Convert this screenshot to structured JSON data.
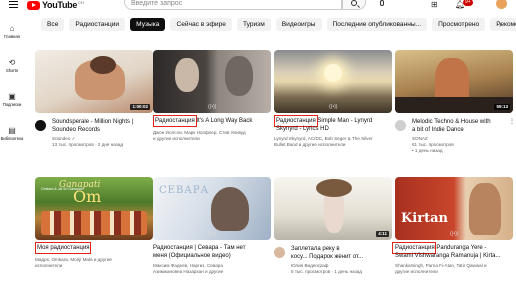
{
  "header": {
    "logo_text": "YouTube",
    "logo_country": "CH",
    "search_placeholder": "Введите запрос",
    "notifications_count": "9+"
  },
  "sidebar": {
    "items": [
      {
        "label": "Главная",
        "icon": "home-icon"
      },
      {
        "label": "Shorts",
        "icon": "shorts-icon"
      },
      {
        "label": "Подписки",
        "icon": "subscriptions-icon"
      },
      {
        "label": "Библиотека",
        "icon": "library-icon"
      }
    ]
  },
  "chips": [
    "Все",
    "Радиостанции",
    "Музыка",
    "Сейчас в эфире",
    "Туризм",
    "Видеоигры",
    "Последние опубликованны...",
    "Просмотрено",
    "Рекомендов"
  ],
  "chips_active": "Музыка",
  "videos": [
    {
      "title1": "Soundsperale - Million Nights |",
      "title2": "Soundeo Records",
      "channel": "Soundeo ✓",
      "stats": "13 тыс. просмотров · 2 дня назад",
      "duration": "1:00:02",
      "colors": [
        "#e9e2d9",
        "#b9876a"
      ]
    },
    {
      "label": "Радиостанция",
      "title1": "It's A Long Way Back",
      "artists": "Джон Иллсли, Марк Нопфлер, Стив Уинвуд",
      "more": "и другие исполнители",
      "colors": [
        "#3f3a38",
        "#9a8f86"
      ]
    },
    {
      "label": "Радиостанция",
      "title1": "Simple Man - Lynyrd",
      "title2": "Skynyrd - Lyrics HD",
      "artists": "Lynyrd Skynyrd, AC/DC, Bob Seger & The Silver",
      "more": "Bullet Band и другие исполнители",
      "colors": [
        "#d8c8a8",
        "#6a5a42"
      ]
    },
    {
      "title1": "Melodic Techno & House with",
      "title2": "a bit of Indie Dance",
      "channel": "SONAZ",
      "stats": "61 тыс. просмотров",
      "ago": "1 день назад",
      "duration": "59:13",
      "colors": [
        "#c0a46e",
        "#5a3e2a"
      ]
    },
    {
      "label": "Моя радиостанция",
      "thumb_text1": "Ganapati",
      "thumb_text2": "Om",
      "thumb_sub": "Omkara & Jai Sri Ganapati",
      "artists": "Мадрх, Omkara, Moriji Mala и другие",
      "more": "исполнители",
      "colors": [
        "#4a7a2e",
        "#c08a3a"
      ]
    },
    {
      "title1": "Радиостанция | Севара - Там нет",
      "title2": "меня (Официальное видео)",
      "artists": "Максим Фадеев, Наргиз, Севара",
      "more": "Азимжановна Назархан и другие",
      "thumb_text1": "СЕВАРА",
      "colors": [
        "#e8edf2",
        "#8fa2b8"
      ]
    },
    {
      "title1": "Заплетала реку в",
      "title2": "косу... Подарок женит от...",
      "channel": "Юлия Видеограф",
      "stats": "5 тыс. просмотров · 1 день назад",
      "duration": "4:11",
      "colors": [
        "#f2efe6",
        "#a8a59c"
      ]
    },
    {
      "label": "Радиостанция",
      "title1": "Panduranga Yere -",
      "title2": "Swami Vishwaranga Ramanuja | Kirta...",
      "artists": "Shankarsingh, Parna Fi-Atan, Tatir Qawwal и",
      "more": "другие исполнители",
      "thumb_text1": "Kirtan",
      "colors": [
        "#b63a2a",
        "#e6c9a8"
      ]
    }
  ]
}
